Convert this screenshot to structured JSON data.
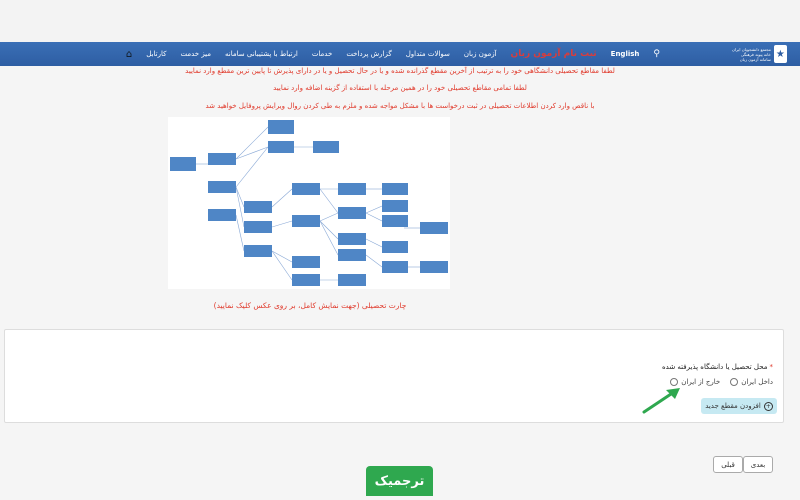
{
  "navbar": {
    "logo_lines": [
      "مجتمع دانشجویان ایران",
      "خانه پیوند فرهنگی",
      "سامانه آزمون زبان"
    ],
    "items": [
      "کارتابل",
      "میز خدمت",
      "ارتباط با پشتیبانی سامانه",
      "خدمات",
      "گزارش پرداخت",
      "سوالات متداول",
      "آزمون زبان"
    ],
    "exam_label": "ثبت نام آزمون زبان",
    "english_label": "English"
  },
  "notices": [
    "لطفا مقاطع تحصیلی دانشگاهی خود را به ترتیب از آخرین مقطع گذرانده شده و یا در حال تحصیل و یا در دارای پذیرش تا پایین ترین مقطع وارد نمایید",
    "لطفا تمامی مقاطع تحصیلی خود را در همین مرحله با استفاده از گزینه اضافه وارد نمایید",
    "با ناقص وارد کردن اطلاعات تحصیلی در ثبت درخواست ها با مشکل مواجه شده و ملزم به طی کردن روال ویرایش پروفایل خواهید شد"
  ],
  "chart_caption": "چارت تحصیلی (جهت نمایش کامل، بر روی عکس کلیک نمایید)",
  "form": {
    "required_mark": "*",
    "label": "محل تحصیل یا دانشگاه پذیرفته شده",
    "options": [
      "خارج از ایران",
      "داخل ایران"
    ],
    "add_button": "افزودن مقطع جدید"
  },
  "nav_buttons": {
    "next": "بعدی",
    "prev": "قبلی"
  },
  "brand": "ترجمیک"
}
